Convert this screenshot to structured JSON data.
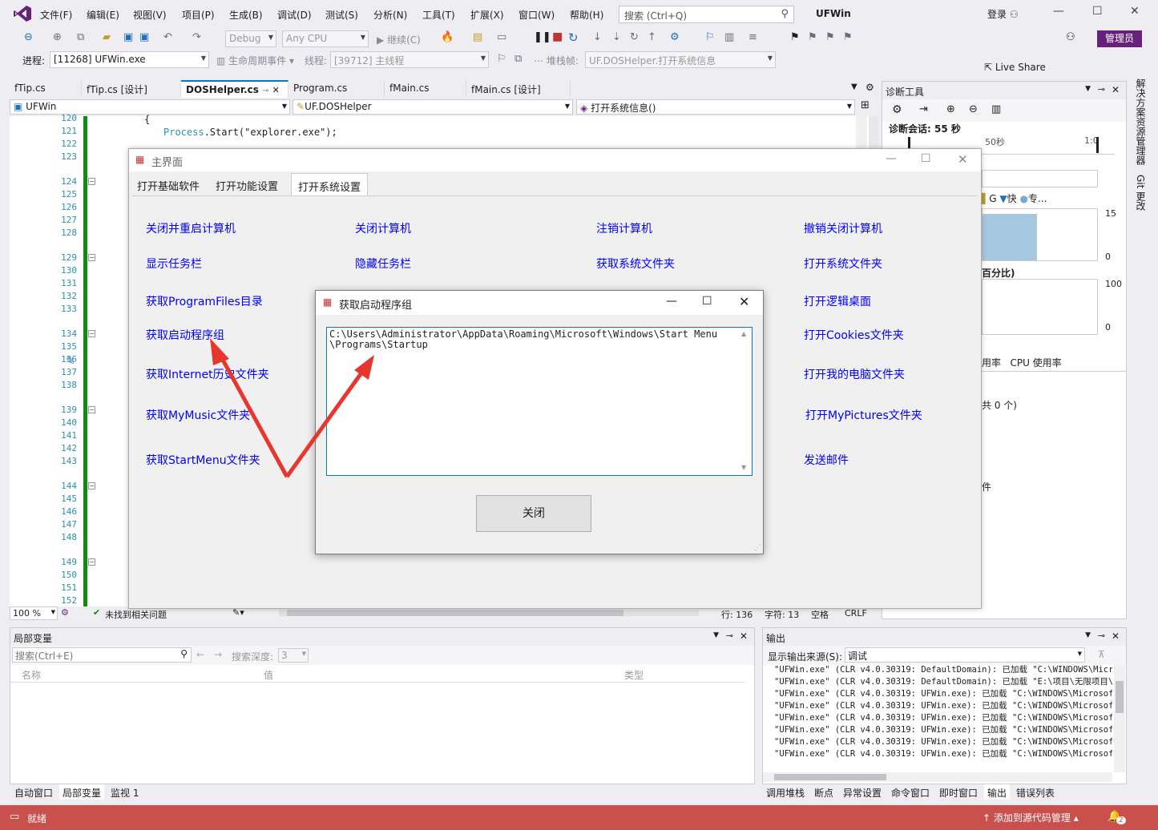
{
  "menu": [
    "文件(F)",
    "编辑(E)",
    "视图(V)",
    "项目(P)",
    "生成(B)",
    "调试(D)",
    "测试(S)",
    "分析(N)",
    "工具(T)",
    "扩展(X)",
    "窗口(W)",
    "帮助(H)"
  ],
  "search": {
    "placeholder": "搜索 (Ctrl+Q)"
  },
  "solution_name": "UFWin",
  "login_label": "登录",
  "toolbar": {
    "config": "Debug",
    "platform": "Any CPU",
    "continue_label": "继续(C)",
    "live_share": "Live Share",
    "admin_badge": "管理员",
    "process_label": "进程:",
    "process_value": "[11268] UFWin.exe",
    "lifecycle_label": "生命周期事件",
    "thread_label": "线程:",
    "thread_value": "[39712] 主线程",
    "stackframe_label": "堆栈帧:",
    "stackframe_value": "UF.DOSHelper.打开系统信息"
  },
  "right_rail": [
    "解决方案资源管理器",
    "Git 更改"
  ],
  "doc_tabs": [
    "fTip.cs",
    "fTip.cs [设计]",
    "DOSHelper.cs",
    "Program.cs",
    "fMain.cs",
    "fMain.cs [设计]"
  ],
  "nav": {
    "project": "UFWin",
    "class": "UF.DOSHelper",
    "member": "打开系统信息()"
  },
  "editor": {
    "line_numbers": [
      120,
      121,
      122,
      123,
      124,
      125,
      126,
      127,
      128,
      129,
      130,
      131,
      132,
      133,
      134,
      135,
      136,
      137,
      138,
      139,
      140,
      141,
      142,
      143,
      144,
      145,
      146,
      147,
      148,
      149,
      150,
      151,
      152
    ],
    "code_class": "Process",
    "code_rest": ".Start(\"explorer.exe\");",
    "code_brace": "{"
  },
  "editor_status": {
    "zoom": "100 %",
    "issues": "未找到相关问题",
    "row": "行: 136",
    "col": "字符: 13",
    "space": "空格",
    "eol": "CRLF"
  },
  "main_form": {
    "title": "主界面",
    "tabs": [
      "打开基础软件",
      "打开功能设置",
      "打开系统设置"
    ],
    "links": [
      "关闭并重启计算机",
      "关闭计算机",
      "注销计算机",
      "撤销关闭计算机",
      "显示任务栏",
      "隐藏任务栏",
      "获取系统文件夹",
      "打开系统文件夹",
      "获取ProgramFiles目录",
      "打开逻辑桌面",
      "获取启动程序组",
      "打开Cookies文件夹",
      "获取Internet历史文件夹",
      "打开我的电脑文件夹",
      "获取MyMusic文件夹",
      "打开MyPictures文件夹",
      "获取StartMenu文件夹",
      "发送邮件"
    ]
  },
  "dialog": {
    "title": "获取启动程序组",
    "text": "C:\\Users\\Administrator\\AppData\\Roaming\\Microsoft\\Windows\\Start Menu\n\\Programs\\Startup",
    "close_button": "关闭"
  },
  "diagnostics": {
    "title": "诊断工具",
    "session": "诊断会话: 55 秒",
    "time_marks": [
      "50秒",
      "1:0"
    ],
    "legend": [
      "G",
      "快",
      "专..."
    ],
    "chart1_max": "15",
    "chart1_min": "0",
    "section2": "百分比)",
    "chart2_max": "100",
    "chart2_min": "0",
    "tabs": [
      "用率",
      "CPU 使用率"
    ],
    "events": "共 0 个)",
    "misc": "件"
  },
  "locals": {
    "title": "局部变量",
    "search_placeholder": "搜索(Ctrl+E)",
    "depth_label": "搜索深度:",
    "depth_value": "3",
    "columns": [
      "名称",
      "值",
      "类型"
    ]
  },
  "output": {
    "title": "输出",
    "source_label": "显示输出来源(S):",
    "source_value": "调试",
    "lines": [
      "\"UFWin.exe\" (CLR v4.0.30319: DefaultDomain): 已加载 \"C:\\WINDOWS\\Micros",
      "\"UFWin.exe\" (CLR v4.0.30319: DefaultDomain): 已加载 \"E:\\项目\\无限项目\\",
      "\"UFWin.exe\" (CLR v4.0.30319: UFWin.exe): 已加载 \"C:\\WINDOWS\\Microsoft.",
      "\"UFWin.exe\" (CLR v4.0.30319: UFWin.exe): 已加载 \"C:\\WINDOWS\\Microsoft.",
      "\"UFWin.exe\" (CLR v4.0.30319: UFWin.exe): 已加载 \"C:\\WINDOWS\\Microsoft.",
      "\"UFWin.exe\" (CLR v4.0.30319: UFWin.exe): 已加载 \"C:\\WINDOWS\\Microsoft.",
      "\"UFWin.exe\" (CLR v4.0.30319: UFWin.exe): 已加载 \"C:\\WINDOWS\\Microsoft.",
      "\"UFWin.exe\" (CLR v4.0.30319: UFWin.exe): 已加载 \"C:\\WINDOWS\\Microsoft."
    ]
  },
  "bottom_tabs_left": [
    "自动窗口",
    "局部变量",
    "监视 1"
  ],
  "bottom_tabs_right": [
    "调用堆栈",
    "断点",
    "异常设置",
    "命令窗口",
    "即时窗口",
    "输出",
    "错误列表"
  ],
  "status": {
    "ready": "就绪",
    "source_control": "添加到源代码管理",
    "notifications": "2"
  },
  "colors": {
    "accent": "#007acc",
    "status_bar": "#c9504c",
    "link": "#0000ff",
    "arrow": "#e8352e",
    "admin": "#68217a"
  }
}
